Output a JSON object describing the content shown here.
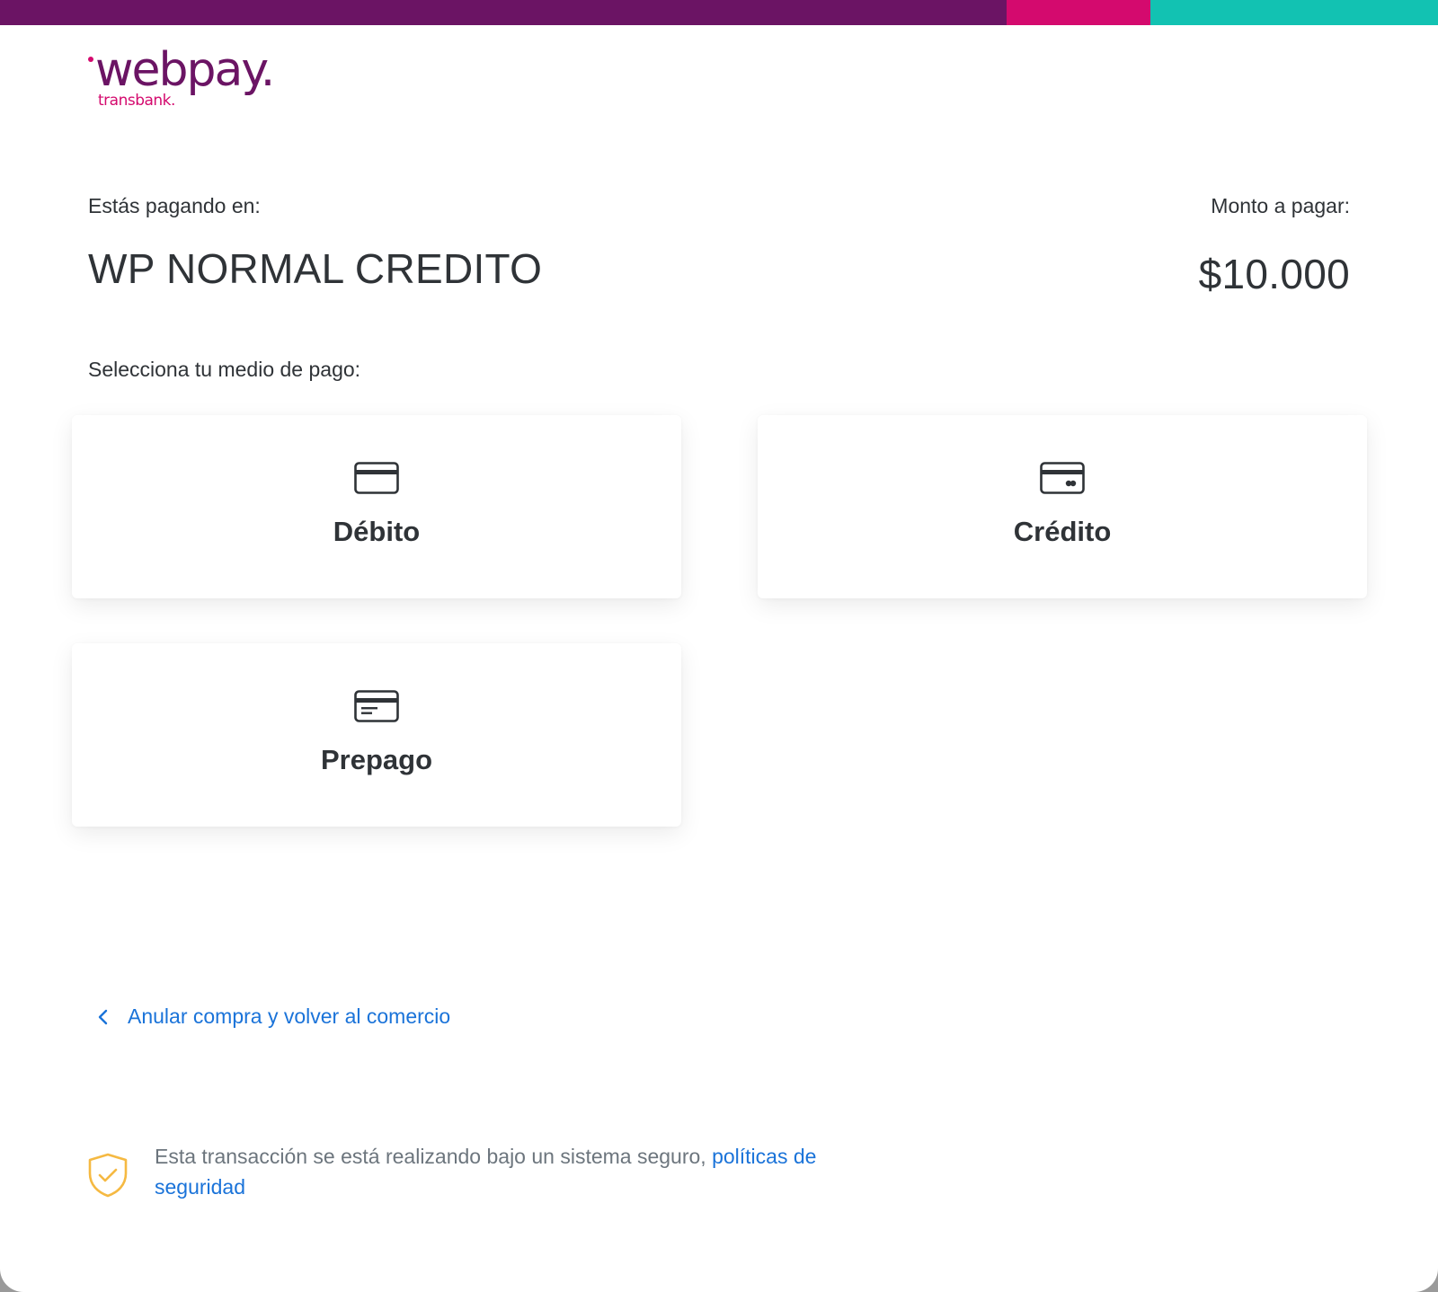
{
  "brand": {
    "logo_word": "webpay.",
    "logo_sub": "transbank.",
    "colors": {
      "purple": "#6b1464",
      "pink": "#d40a6e",
      "teal": "#12c2b2",
      "text": "#2f3337",
      "link": "#1a73d9",
      "shield": "#f5b942"
    }
  },
  "header": {
    "paying_label": "Estás pagando en:",
    "merchant_name": "WP NORMAL CREDITO",
    "amount_label": "Monto a pagar:",
    "amount_value": "$10.000"
  },
  "payment": {
    "select_label": "Selecciona tu medio de pago:",
    "methods": [
      {
        "label": "Débito",
        "icon": "debit-card-icon"
      },
      {
        "label": "Crédito",
        "icon": "credit-card-icon"
      },
      {
        "label": "Prepago",
        "icon": "prepaid-card-icon"
      }
    ]
  },
  "footer": {
    "back_link": "Anular compra y volver al comercio",
    "back_icon": "chevron-left-icon",
    "security_text": "Esta transacción se está realizando bajo un sistema seguro, ",
    "security_link": "políticas de seguridad",
    "security_icon": "shield-check-icon"
  }
}
